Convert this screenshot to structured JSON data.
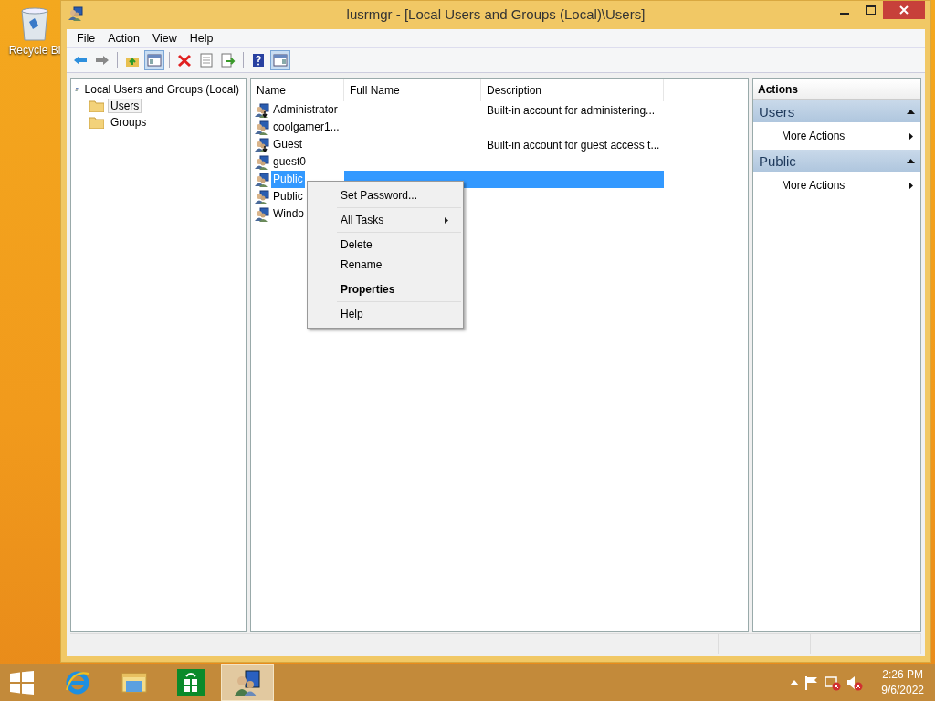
{
  "desktop": {
    "icons": [
      {
        "label": "Recycle Bi"
      }
    ]
  },
  "window": {
    "title": "lusrmgr - [Local Users and Groups (Local)\\Users]"
  },
  "menu_bar": [
    "File",
    "Action",
    "View",
    "Help"
  ],
  "toolbar": [
    [
      {
        "kind": "back",
        "selected": false
      },
      {
        "kind": "forward",
        "selected": false
      }
    ],
    [
      {
        "kind": "up",
        "selected": false
      },
      {
        "kind": "console-tree",
        "selected": true
      }
    ],
    [
      {
        "kind": "delete",
        "selected": false
      },
      {
        "kind": "properties",
        "selected": false
      },
      {
        "kind": "export",
        "selected": false
      }
    ],
    [
      {
        "kind": "help",
        "selected": false
      },
      {
        "kind": "action-pane",
        "selected": true
      }
    ]
  ],
  "tree": [
    {
      "label": "Local Users and Groups (Local)",
      "selected": false,
      "children": [
        {
          "label": "Users",
          "selected": true
        },
        {
          "label": "Groups",
          "selected": false
        }
      ]
    }
  ],
  "list": {
    "columns": [
      "Name",
      "Full Name",
      "Description"
    ],
    "rows": [
      {
        "name": "Administrator",
        "description": "Built-in account for administering...",
        "disabled": true,
        "selected": false
      },
      {
        "name": "coolgamer1...",
        "disabled": false,
        "selected": false
      },
      {
        "name": "Guest",
        "description": "Built-in account for guest access t...",
        "disabled": true,
        "selected": false
      },
      {
        "name": "guest0",
        "disabled": false,
        "selected": false
      },
      {
        "name": "Public",
        "disabled": false,
        "selected": true
      },
      {
        "name": "Public",
        "disabled": false,
        "selected": false
      },
      {
        "name": "Windo",
        "disabled": false,
        "selected": false
      }
    ]
  },
  "context_menu": [
    [
      {
        "label": "Set Password...",
        "submenu": false,
        "default": false
      }
    ],
    [
      {
        "label": "All Tasks",
        "submenu": true,
        "default": false
      }
    ],
    [
      {
        "label": "Delete",
        "submenu": false,
        "default": false
      },
      {
        "label": "Rename",
        "submenu": false,
        "default": false
      }
    ],
    [
      {
        "label": "Properties",
        "submenu": false,
        "default": true
      }
    ],
    [
      {
        "label": "Help",
        "submenu": false,
        "default": false
      }
    ]
  ],
  "actions": {
    "title": "Actions",
    "sections": [
      {
        "title": "Users",
        "expanded": true,
        "items": [
          "More Actions"
        ]
      },
      {
        "title": "Public",
        "expanded": true,
        "items": [
          "More Actions"
        ]
      }
    ]
  },
  "taskbar": {
    "apps": [
      {
        "kind": "ie",
        "selected": false
      },
      {
        "kind": "explorer",
        "selected": false
      },
      {
        "kind": "store",
        "selected": false
      },
      {
        "kind": "users",
        "selected": true
      }
    ],
    "time": "2:26 PM",
    "date": "9/6/2022"
  }
}
